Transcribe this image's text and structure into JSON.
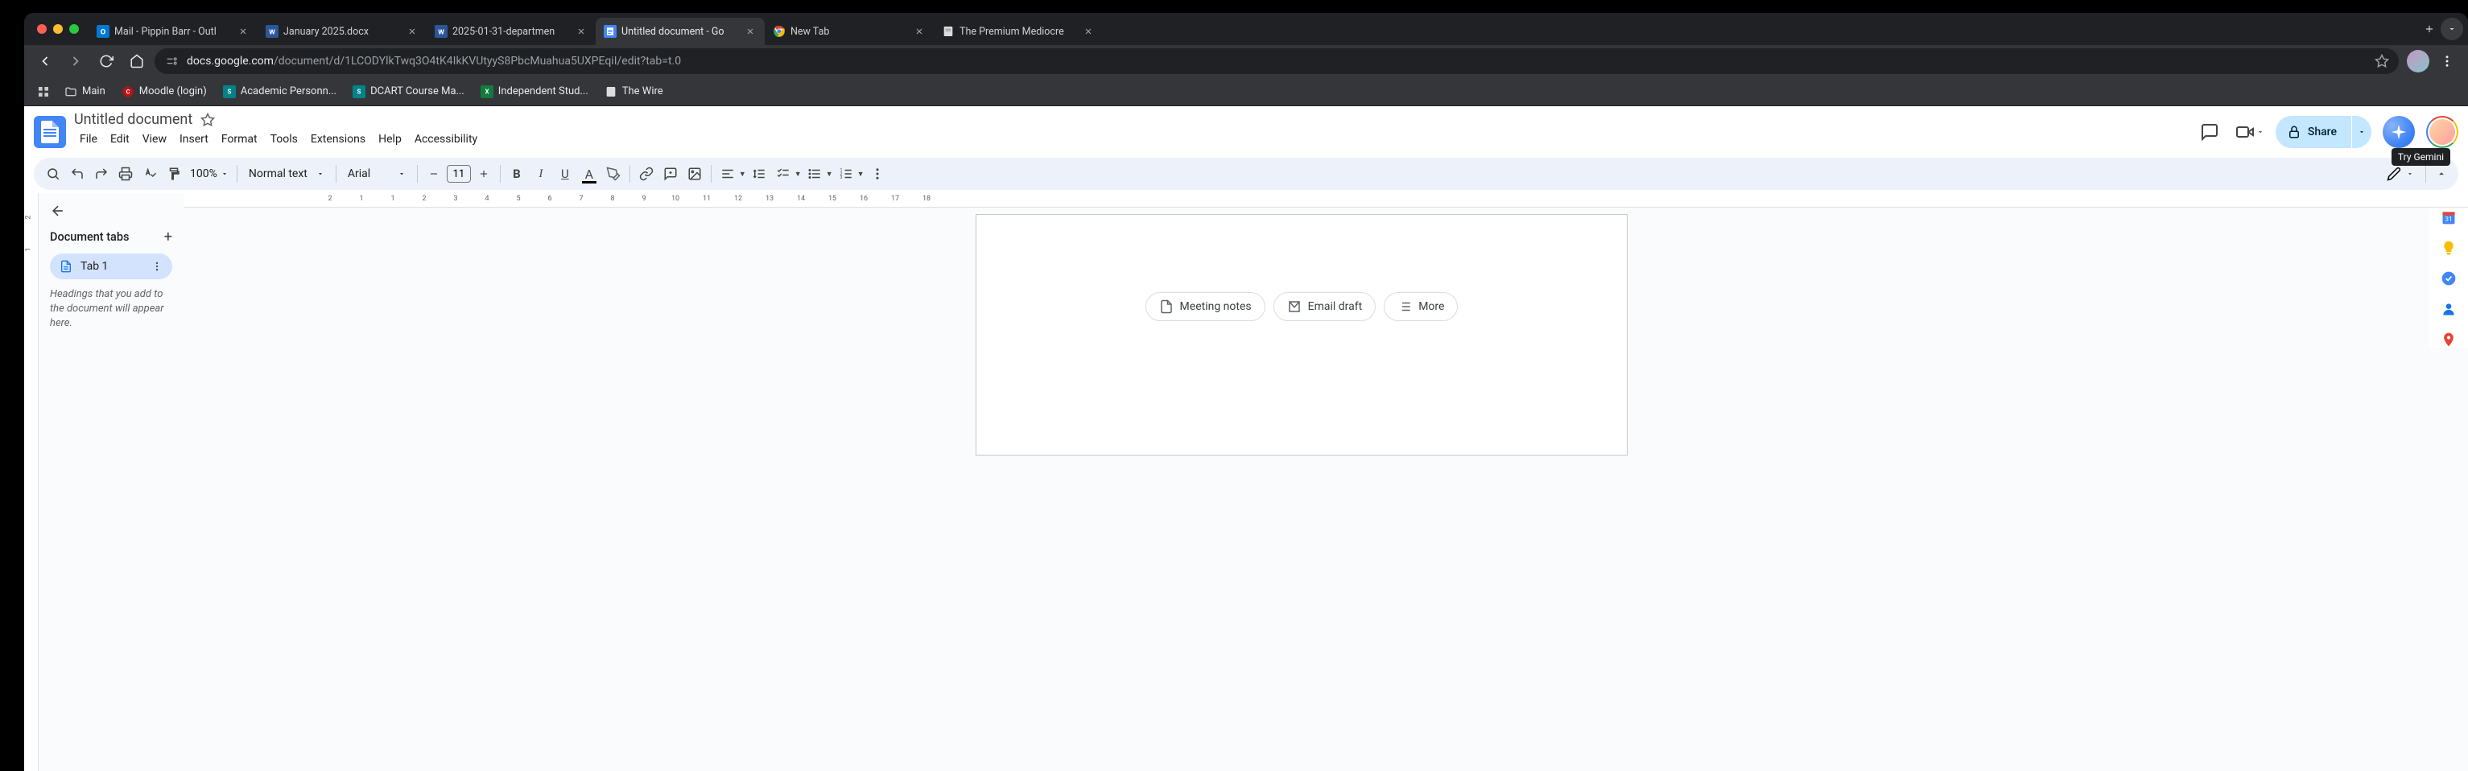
{
  "browser": {
    "tabs": [
      {
        "title": "Mail - Pippin Barr - Outl",
        "icon": "outlook"
      },
      {
        "title": "January 2025.docx",
        "icon": "word"
      },
      {
        "title": "2025-01-31-departmen",
        "icon": "word"
      },
      {
        "title": "Untitled document - Go",
        "icon": "gdocs",
        "active": true
      },
      {
        "title": "New Tab",
        "icon": "chrome"
      },
      {
        "title": "The Premium Mediocre",
        "icon": "page"
      }
    ],
    "url_host": "docs.google.com",
    "url_path": "/document/d/1LCODYlkTwq3O4tK4IkKVUtyyS8PbcMuahua5UXPEqiI/edit?tab=t.0",
    "bookmarks": [
      {
        "label": "Main",
        "icon": "folder"
      },
      {
        "label": "Moodle (login)",
        "icon": "moodle"
      },
      {
        "label": "Academic Personn...",
        "icon": "sp"
      },
      {
        "label": "DCART Course Ma...",
        "icon": "sp"
      },
      {
        "label": "Independent Stud...",
        "icon": "xls"
      },
      {
        "label": "The Wire",
        "icon": "wire"
      }
    ]
  },
  "docs": {
    "title": "Untitled document",
    "menus": [
      "File",
      "Edit",
      "View",
      "Insert",
      "Format",
      "Tools",
      "Extensions",
      "Help",
      "Accessibility"
    ],
    "share_label": "Share",
    "tooltip": "Try Gemini",
    "toolbar": {
      "zoom": "100%",
      "style": "Normal text",
      "font": "Arial",
      "fontsize": "11"
    },
    "outline": {
      "title": "Document tabs",
      "tab_label": "Tab 1",
      "hint": "Headings that you add to the document will appear here."
    },
    "building_blocks": {
      "meeting": "Meeting notes",
      "email": "Email draft",
      "more": "More"
    },
    "ruler_numbers": [
      2,
      1,
      1,
      2,
      3,
      4,
      5,
      6,
      7,
      8,
      9,
      10,
      11,
      12,
      13,
      14,
      15,
      16,
      17,
      18
    ]
  }
}
